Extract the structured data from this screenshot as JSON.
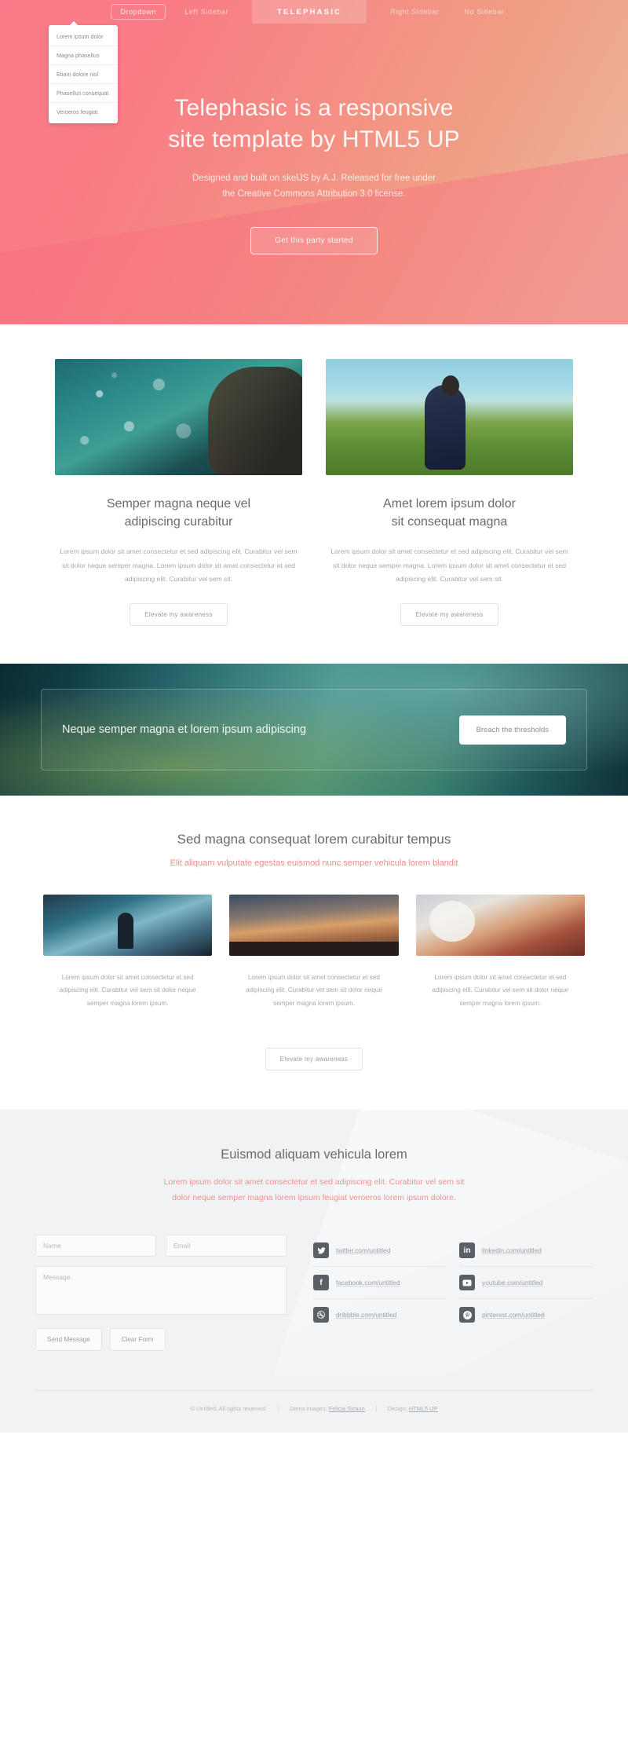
{
  "nav": {
    "dropdown_label": "Dropdown",
    "items": [
      {
        "label": "Left Sidebar",
        "active": false
      },
      {
        "label": "TELEPHASIC",
        "active": true
      },
      {
        "label": "Right Sidebar",
        "active": false
      },
      {
        "label": "No Sidebar",
        "active": false
      }
    ],
    "dropdown_items": [
      "Lorem ipsum dolor",
      "Magna phasellus",
      "Etiam dolore nisl",
      "Phasellus consequat",
      "Veroeros feugiat"
    ]
  },
  "hero": {
    "title_line1": "Telephasic is a responsive",
    "title_line2": "site template by HTML5 UP",
    "sub_line1": "Designed and built on skelJS by A.J. Released for free under",
    "sub_line2": "the Creative Commons Attribution 3.0 license.",
    "button": "Get this party started",
    "accent": "#f9707f",
    "accent2": "#edb79e"
  },
  "features": [
    {
      "image": "man-with-water-droplets",
      "title_line1": "Semper magna neque vel",
      "title_line2": "adipiscing curabitur",
      "body": "Lorem ipsum dolor sit amet consectetur et sed adipiscing elit. Curabitur vel sem sit dolor neque semper magna. Lorem ipsum dolor sit amet consectetur et sed adipiscing elit. Curabitur vel sem sit.",
      "button": "Elevate my awareness"
    },
    {
      "image": "woman-in-field",
      "title_line1": "Amet lorem ipsum dolor",
      "title_line2": "sit consequat magna",
      "body": "Lorem ipsum dolor sit amet consectetur et sed adipiscing elit. Curabitur vel sem sit dolor neque semper magna. Lorem ipsum dolor sit amet consectetur et sed adipiscing elit. Curabitur vel sem sit.",
      "button": "Elevate my awareness"
    }
  ],
  "banner": {
    "text": "Neque semper magna et lorem ipsum adipiscing",
    "button": "Breach the thresholds"
  },
  "three": {
    "title": "Sed magna consequat lorem curabitur tempus",
    "subtitle": "Elit aliquam vulputate egestas euismod nunc semper vehicula lorem blandit",
    "subtitle_color": "#f08a86",
    "items": [
      {
        "image": "person-in-doorway",
        "body": "Lorem ipsum dolor sit amet consectetur et sed adipiscing elit. Curabitur vel sem sit dolor neque semper magna lorem ipsum."
      },
      {
        "image": "wind-turbines-sunset",
        "body": "Lorem ipsum dolor sit amet consectetur et sed adipiscing elit. Curabitur vel sem sit dolor neque semper magna lorem ipsum."
      },
      {
        "image": "woman-with-flowers",
        "body": "Lorem ipsum dolor sit amet consectetur et sed adipiscing elit. Curabitur vel sem sit dolor neque semper magna lorem ipsum."
      }
    ],
    "button": "Elevate my awareness"
  },
  "contact": {
    "title": "Euismod aliquam vehicula lorem",
    "sub_line1": "Lorem ipsum dolor sit amet consectetur et sed adipiscing elit. Curabitur vel sem sit",
    "sub_line2": "dolor neque semper magna lorem ipsum feugiat veroeros lorem ipsum dolore.",
    "form": {
      "name_placeholder": "Name",
      "email_placeholder": "Email",
      "message_placeholder": "Message",
      "send_label": "Send Message",
      "clear_label": "Clear Form"
    },
    "social": [
      {
        "icon": "twitter-icon",
        "label": "twitter.com/untitled"
      },
      {
        "icon": "linkedin-icon",
        "label": "linkedin.com/untitled"
      },
      {
        "icon": "facebook-icon",
        "label": "facebook.com/untitled"
      },
      {
        "icon": "youtube-icon",
        "label": "youtube.com/untitled"
      },
      {
        "icon": "dribbble-icon",
        "label": "dribbble.com/untitled"
      },
      {
        "icon": "pinterest-icon",
        "label": "pinterest.com/untitled"
      }
    ]
  },
  "footer": {
    "copyright": "© Untitled. All rights reserved.",
    "demo_label": "Demo images:",
    "demo_link": "Felicia Simion",
    "design_label": "Design:",
    "design_link": "HTML5 UP"
  }
}
